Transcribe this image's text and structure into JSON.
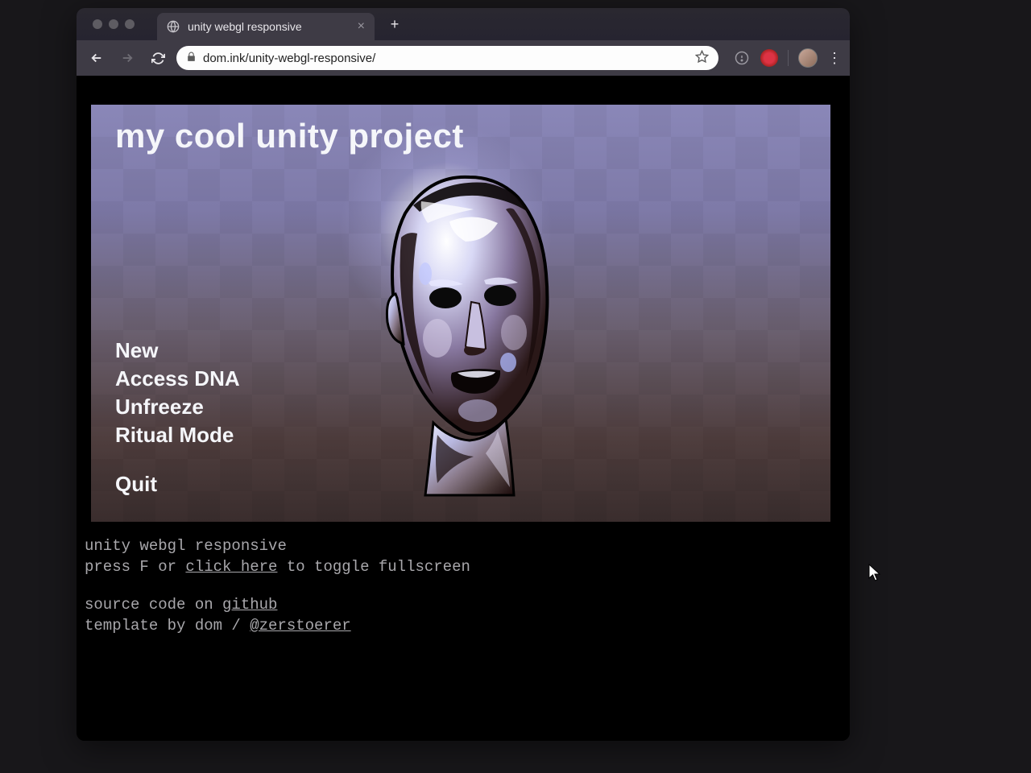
{
  "browser": {
    "tab_title": "unity webgl responsive",
    "url": "dom.ink/unity-webgl-responsive/"
  },
  "canvas": {
    "title": "my cool unity project",
    "menu": [
      "New",
      "Access DNA",
      "Unfreeze",
      "Ritual Mode"
    ],
    "quit": "Quit"
  },
  "footer": {
    "line1": "unity webgl responsive",
    "line2_pre": "press F or ",
    "line2_link": "click here",
    "line2_post": " to toggle fullscreen",
    "line3_pre": "source code on ",
    "line3_link": "github",
    "line4_pre": "template by dom / ",
    "line4_link": "@zerstoerer"
  }
}
